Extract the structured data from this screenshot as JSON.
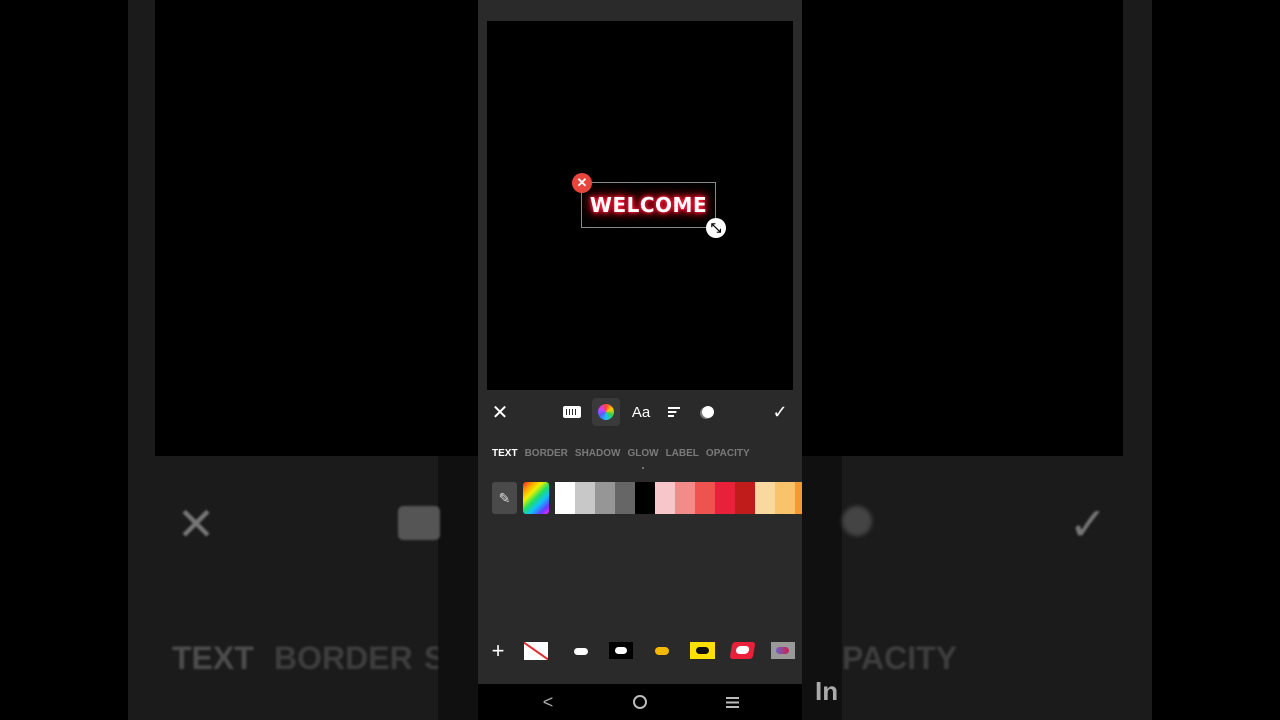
{
  "background": {
    "blurred_tabs": [
      "TEXT",
      "BORDER",
      "S",
      "PACITY"
    ],
    "watermark": "In"
  },
  "editor": {
    "text_element": {
      "content": "WELCOME",
      "glow_color": "#ff1f3d"
    },
    "delete_icon": "close-icon",
    "resize_icon": "resize-icon"
  },
  "toolbar": {
    "close_icon": "✕",
    "font_label": "Aa",
    "confirm_icon": "✓",
    "selected_tool": "color"
  },
  "tabs": [
    {
      "label": "TEXT",
      "active": true
    },
    {
      "label": "BORDER",
      "active": false
    },
    {
      "label": "SHADOW",
      "active": false
    },
    {
      "label": "GLOW",
      "active": false
    },
    {
      "label": "LABEL",
      "active": false
    },
    {
      "label": "OPACITY",
      "active": false
    }
  ],
  "palette": {
    "picker_icon": "eyedropper-icon",
    "swatches": [
      "#ffffff",
      "#c8c8c8",
      "#969696",
      "#666666",
      "#000000",
      "#f7c6cb",
      "#f38b8b",
      "#ef5350",
      "#e8203a",
      "#c01c1c",
      "#f9d9a0",
      "#f8c36a",
      "#f59a30"
    ]
  },
  "labels": {
    "add_label": "+"
  },
  "navbar": {
    "back_icon": "<"
  }
}
